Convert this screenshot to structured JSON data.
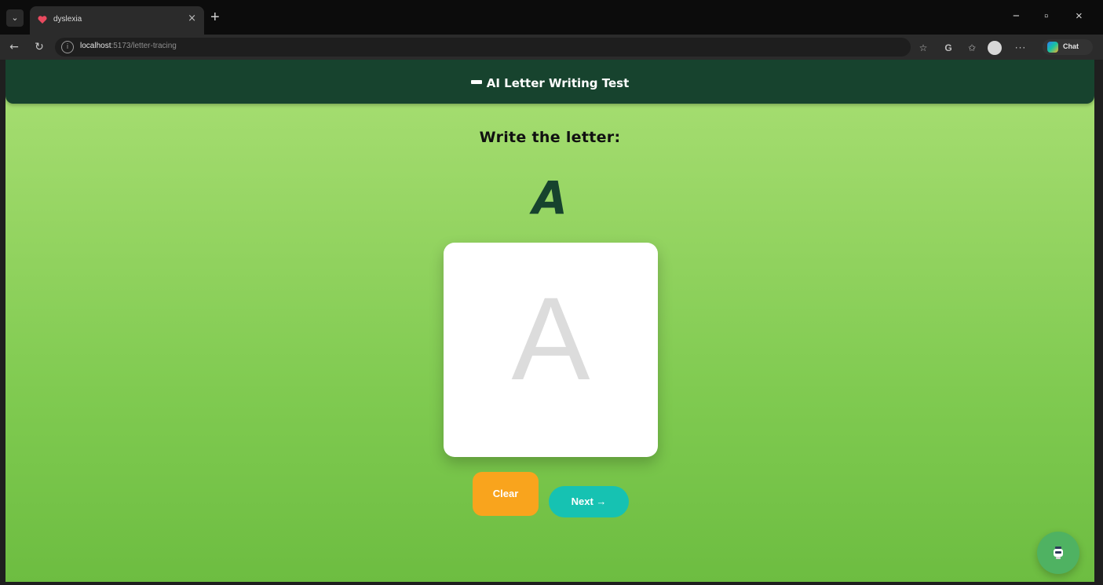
{
  "browser": {
    "tab_menu_icon": "chevron-down-icon",
    "tab_title": "dyslexia",
    "tab_close": "×",
    "new_tab": "+",
    "window_controls": {
      "minimize": "−",
      "maximize": "▫",
      "close": "×"
    },
    "url_host": "localhost",
    "url_path": ":5173/letter-tracing",
    "chat_label": "Chat",
    "toolbar_icons": [
      "star-icon",
      "g-icon",
      "favorites-icon",
      "profile-avatar",
      "more-icon"
    ]
  },
  "header": {
    "title": "AI Letter Writing Test",
    "icon": "pencil-icon"
  },
  "main": {
    "prompt": "Write the letter:",
    "target_letter": "A",
    "trace_letter": "A"
  },
  "actions": {
    "clear_label": "Clear",
    "next_label": "Next →"
  },
  "fab": {
    "icon": "robot-icon"
  },
  "colors": {
    "header_bg": "#17432e",
    "page_gradient_top": "#a9df74",
    "page_gradient_bottom": "#6dbd41",
    "clear_button": "#f9a41d",
    "next_button": "#16c2b2",
    "fab_bg": "#4fb262",
    "target_letter": "#17432e"
  }
}
